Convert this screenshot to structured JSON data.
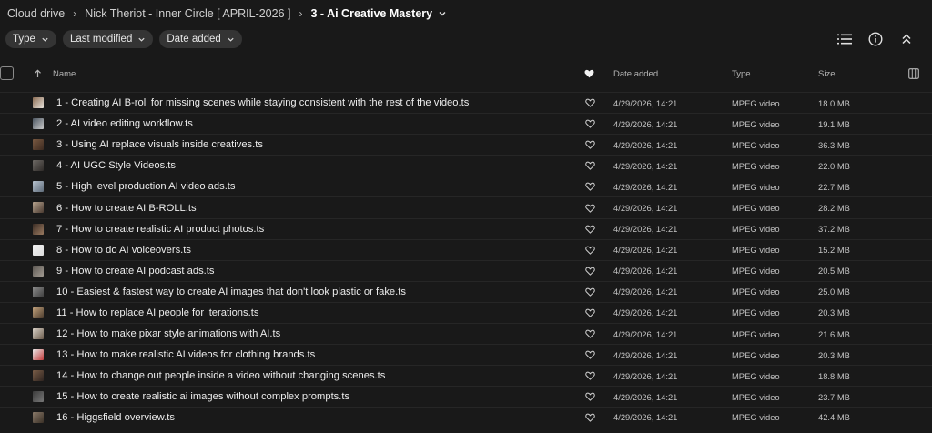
{
  "breadcrumb": {
    "items": [
      "Cloud drive",
      "Nick Theriot - Inner Circle [ APRIL-2026 ]"
    ],
    "current": "3 - Ai Creative Mastery",
    "separator": "›"
  },
  "filters": [
    {
      "label": "Type"
    },
    {
      "label": "Last modified"
    },
    {
      "label": "Date added"
    }
  ],
  "columns": {
    "name": "Name",
    "date_added": "Date added",
    "type": "Type",
    "size": "Size"
  },
  "files": [
    {
      "name": "1 - Creating AI B-roll for missing scenes while staying consistent with the rest of the video.ts",
      "date": "4/29/2026, 14:21",
      "type": "MPEG video",
      "size": "18.0 MB",
      "thumb": [
        "#8a6b52",
        "#e8e3dc"
      ]
    },
    {
      "name": "2 - AI video editing workflow.ts",
      "date": "4/29/2026, 14:21",
      "type": "MPEG video",
      "size": "19.1 MB",
      "thumb": [
        "#4b5560",
        "#c9c9c9"
      ]
    },
    {
      "name": "3 - Using AI replace visuals inside creatives.ts",
      "date": "4/29/2026, 14:21",
      "type": "MPEG video",
      "size": "36.3 MB",
      "thumb": [
        "#7a5a42",
        "#3c2a20"
      ]
    },
    {
      "name": "4 - AI UGC Style Videos.ts",
      "date": "4/29/2026, 14:21",
      "type": "MPEG video",
      "size": "22.0 MB",
      "thumb": [
        "#6e6a66",
        "#2e2a28"
      ]
    },
    {
      "name": "5 - High level production AI video ads.ts",
      "date": "4/29/2026, 14:21",
      "type": "MPEG video",
      "size": "22.7 MB",
      "thumb": [
        "#b8c3cf",
        "#5f6c7a"
      ]
    },
    {
      "name": "6 - How to create AI B-ROLL.ts",
      "date": "4/29/2026, 14:21",
      "type": "MPEG video",
      "size": "28.2 MB",
      "thumb": [
        "#b7a48f",
        "#4a3a30"
      ]
    },
    {
      "name": "7 - How to create realistic AI product photos.ts",
      "date": "4/29/2026, 14:21",
      "type": "MPEG video",
      "size": "37.2 MB",
      "thumb": [
        "#3a2c24",
        "#9a7a60"
      ]
    },
    {
      "name": "8 - How to do AI voiceovers.ts",
      "date": "4/29/2026, 14:21",
      "type": "MPEG video",
      "size": "15.2 MB",
      "thumb": [
        "#f2f2f2",
        "#dcdcdc"
      ]
    },
    {
      "name": "9 - How to create AI podcast ads.ts",
      "date": "4/29/2026, 14:21",
      "type": "MPEG video",
      "size": "20.5 MB",
      "thumb": [
        "#5c5752",
        "#a29b92"
      ]
    },
    {
      "name": "10 - Easiest & fastest way to create AI images that don't look plastic or fake.ts",
      "date": "4/29/2026, 14:21",
      "type": "MPEG video",
      "size": "25.0 MB",
      "thumb": [
        "#8f8f8f",
        "#3d3d3d"
      ]
    },
    {
      "name": "11 - How to replace AI people for iterations.ts",
      "date": "4/29/2026, 14:21",
      "type": "MPEG video",
      "size": "20.3 MB",
      "thumb": [
        "#c2a27c",
        "#4a3a2c"
      ]
    },
    {
      "name": "12 - How to make pixar style animations with AI.ts",
      "date": "4/29/2026, 14:21",
      "type": "MPEG video",
      "size": "21.6 MB",
      "thumb": [
        "#d9d2c8",
        "#6b5b4c"
      ]
    },
    {
      "name": "13 - How to make realistic AI videos for clothing brands.ts",
      "date": "4/29/2026, 14:21",
      "type": "MPEG video",
      "size": "20.3 MB",
      "thumb": [
        "#ececec",
        "#c23b3b"
      ]
    },
    {
      "name": "14 - How to change out people inside a video without changing scenes.ts",
      "date": "4/29/2026, 14:21",
      "type": "MPEG video",
      "size": "18.8 MB",
      "thumb": [
        "#7a5e48",
        "#2e2420"
      ]
    },
    {
      "name": "15 - How to create realistic ai images without complex prompts.ts",
      "date": "4/29/2026, 14:21",
      "type": "MPEG video",
      "size": "23.7 MB",
      "thumb": [
        "#3a3a3a",
        "#777777"
      ]
    },
    {
      "name": "16 - Higgsfield overview.ts",
      "date": "4/29/2026, 14:21",
      "type": "MPEG video",
      "size": "42.4 MB",
      "thumb": [
        "#8a7a6a",
        "#3a3026"
      ]
    }
  ],
  "icons": {
    "filter_chip": "chevron-down-icon",
    "view_toggle": "list-view-icon",
    "info": "info-icon",
    "collapse": "collapse-icon",
    "sort": "sort-up-arrow-icon",
    "favorite": "heart-icon",
    "column_settings": "column-settings-icon"
  }
}
